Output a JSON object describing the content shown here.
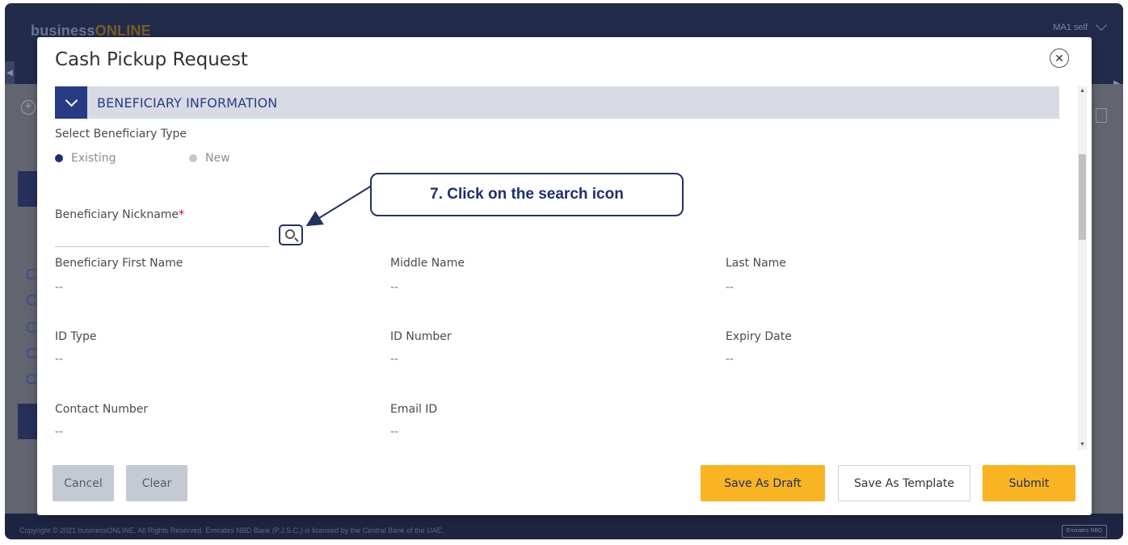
{
  "background": {
    "brand_prefix": "business",
    "brand_suffix": "ONLINE",
    "user_label": "MA1 self",
    "copyright": "Copyright © 2021 businessONLINE. All Rights Reserved. Emirates NBD Bank (P.J.S.C.) is licensed by the Central Bank of the UAE.",
    "logo_badge": "Emirates NBD"
  },
  "modal": {
    "title": "Cash Pickup Request",
    "close_icon": "close-icon",
    "section": {
      "title": "BENEFICIARY INFORMATION",
      "toggle_icon": "chevron-down-icon"
    },
    "beneficiary_type": {
      "label": "Select Beneficiary Type",
      "options": [
        {
          "label": "Existing",
          "selected": true
        },
        {
          "label": "New",
          "selected": false
        }
      ]
    },
    "nickname": {
      "label": "Beneficiary Nickname",
      "required_marker": "*",
      "value": "",
      "search_icon": "search-icon"
    },
    "fields": {
      "first_name": {
        "label": "Beneficiary First Name",
        "value": "--"
      },
      "middle_name": {
        "label": "Middle Name",
        "value": "--"
      },
      "last_name": {
        "label": "Last Name",
        "value": "--"
      },
      "id_type": {
        "label": "ID Type",
        "value": "--"
      },
      "id_number": {
        "label": "ID Number",
        "value": "--"
      },
      "expiry_date": {
        "label": "Expiry Date",
        "value": "--"
      },
      "contact_number": {
        "label": "Contact Number",
        "value": "--"
      },
      "email_id": {
        "label": "Email ID",
        "value": "--"
      }
    },
    "buttons": {
      "cancel": "Cancel",
      "clear": "Clear",
      "save_draft": "Save As Draft",
      "save_template": "Save As Template",
      "submit": "Submit"
    },
    "callout": "7.  Click on the search icon"
  },
  "colors": {
    "primary_navy": "#273b85",
    "accent_yellow": "#f9b424",
    "required_red": "#d0021b"
  }
}
